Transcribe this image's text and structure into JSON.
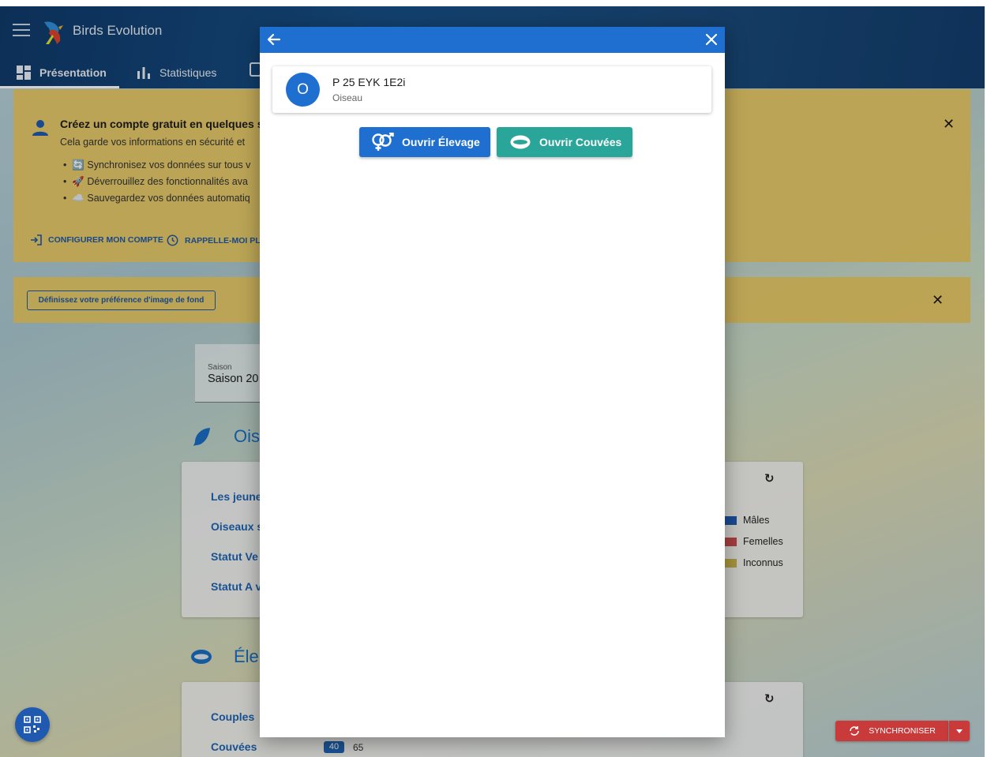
{
  "app": {
    "title": "Birds Evolution",
    "tabs": [
      {
        "label": "Présentation",
        "icon": "dashboard-icon",
        "active": true
      },
      {
        "label": "Statistiques",
        "icon": "bar-chart-icon"
      }
    ]
  },
  "account_banner": {
    "title": "Créez un compte gratuit en quelques s",
    "subtitle": "Cela garde vos informations en sécurité et",
    "bullets": [
      "🔄 Synchronisez vos données sur tous v",
      "🚀 Déverrouillez des fonctionnalités ava",
      "☁️ Sauvegardez vos données automatiq"
    ],
    "actions": {
      "configure": "CONFIGURER MON COMPTE",
      "remind": "RAPPELLE-MOI PLU"
    }
  },
  "background_banner": {
    "button": "Définissez votre préférence d'image de fond"
  },
  "season": {
    "label": "Saison",
    "value": "Saison 20"
  },
  "birds_section": {
    "title": "Ois",
    "links": [
      "Les jeune",
      "Oiseaux s",
      "Statut Ve",
      "Statut A v"
    ],
    "legend": [
      {
        "label": "Mâles",
        "color": "#1f5ab0"
      },
      {
        "label": "Femelles",
        "color": "#c94b4b"
      },
      {
        "label": "Inconnus",
        "color": "#c9b44a"
      }
    ]
  },
  "breeding_section": {
    "title": "Éle",
    "links": [
      "Couples",
      "Couvées"
    ],
    "couvees_badge": "40",
    "couvees_total": "65"
  },
  "sync": {
    "label": "SYNCHRONISER"
  },
  "dialog": {
    "bird": {
      "avatar_letter": "O",
      "name": "P 25 EYK 1E2i",
      "type": "Oiseau"
    },
    "buttons": {
      "elevage": "Ouvrir Élevage",
      "couvees": "Ouvrir Couvées"
    },
    "colors": {
      "primary": "#1f6fd1",
      "teal": "#2aa59a"
    }
  }
}
